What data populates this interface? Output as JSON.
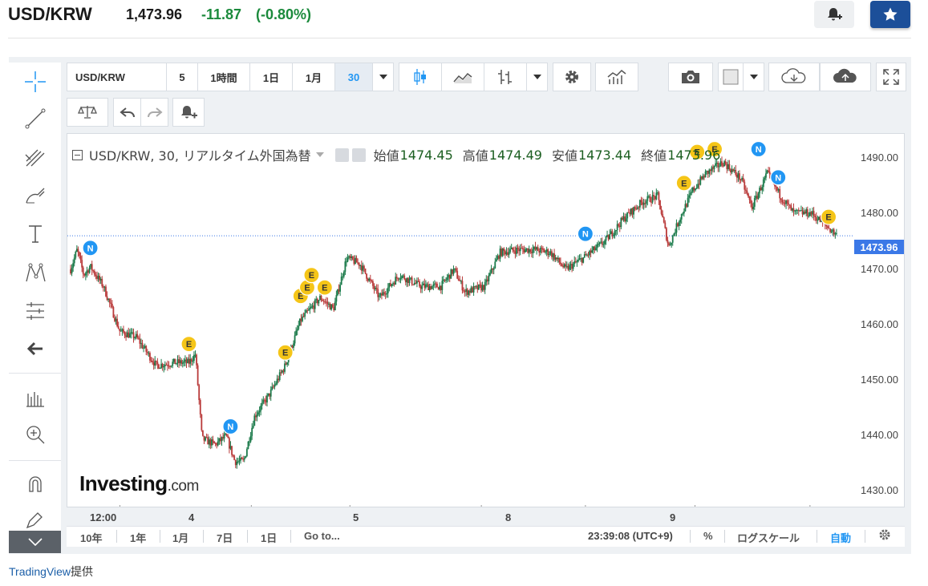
{
  "header": {
    "symbol": "USD/KRW",
    "price": "1,473.96",
    "change": "-11.87",
    "change_pct": "(-0.80%)"
  },
  "toolbar": {
    "symbol": "USD/KRW",
    "intervals": [
      "5",
      "1時間",
      "1日",
      "1月",
      "30"
    ],
    "active_interval": "30"
  },
  "legend": {
    "title": "USD/KRW, 30, リアルタイム外国為替",
    "open_label": "始値",
    "open": "1474.45",
    "high_label": "高値",
    "high": "1474.49",
    "low_label": "安値",
    "low": "1473.44",
    "close_label": "終値",
    "close": "1473.96"
  },
  "y_axis": {
    "labels": [
      "1490.00",
      "1480.00",
      "1470.00",
      "1460.00",
      "1450.00",
      "1440.00",
      "1430.00"
    ],
    "current": "1473.96"
  },
  "x_axis": {
    "labels": [
      "12:00",
      "4",
      "5",
      "8",
      "9"
    ]
  },
  "bottom_bar": {
    "ranges": [
      "10年",
      "1年",
      "1月",
      "7日",
      "1日"
    ],
    "goto": "Go to...",
    "time": "23:39:08 (UTC+9)",
    "percent": "%",
    "log": "ログスケール",
    "auto": "自動"
  },
  "watermark": {
    "brand": "Investing",
    "suffix": ".com"
  },
  "credit": {
    "link": "TradingView",
    "suffix": "提供"
  },
  "colors": {
    "up": "#1b7a4a",
    "down": "#b93a3a",
    "accent": "#2196f3",
    "star_bg": "#1c4f99"
  },
  "chart_data": {
    "type": "candlestick",
    "title": "USD/KRW, 30, リアルタイム外国為替",
    "ylim": [
      1426,
      1492
    ],
    "y_ticks": [
      1430,
      1440,
      1450,
      1460,
      1470,
      1480,
      1490
    ],
    "x_ticks": [
      "12:00",
      "4",
      "5",
      "8",
      "9"
    ],
    "last_price": 1473.96,
    "anchors": [
      {
        "t": 0,
        "v": 1468
      },
      {
        "t": 6,
        "v": 1471.5
      },
      {
        "t": 12,
        "v": 1467
      },
      {
        "t": 18,
        "v": 1468.5
      },
      {
        "t": 30,
        "v": 1465
      },
      {
        "t": 45,
        "v": 1457
      },
      {
        "t": 60,
        "v": 1456
      },
      {
        "t": 78,
        "v": 1451
      },
      {
        "t": 95,
        "v": 1451.5
      },
      {
        "t": 108,
        "v": 1451.5
      },
      {
        "t": 114,
        "v": 1453
      },
      {
        "t": 120,
        "v": 1438
      },
      {
        "t": 132,
        "v": 1437
      },
      {
        "t": 142,
        "v": 1438.5
      },
      {
        "t": 150,
        "v": 1434
      },
      {
        "t": 158,
        "v": 1434
      },
      {
        "t": 168,
        "v": 1442
      },
      {
        "t": 182,
        "v": 1446
      },
      {
        "t": 196,
        "v": 1451
      },
      {
        "t": 210,
        "v": 1459
      },
      {
        "t": 228,
        "v": 1463
      },
      {
        "t": 240,
        "v": 1461
      },
      {
        "t": 252,
        "v": 1470
      },
      {
        "t": 264,
        "v": 1469
      },
      {
        "t": 282,
        "v": 1463
      },
      {
        "t": 300,
        "v": 1467
      },
      {
        "t": 320,
        "v": 1465
      },
      {
        "t": 338,
        "v": 1465
      },
      {
        "t": 350,
        "v": 1468
      },
      {
        "t": 360,
        "v": 1464
      },
      {
        "t": 378,
        "v": 1465
      },
      {
        "t": 392,
        "v": 1471
      },
      {
        "t": 408,
        "v": 1471.5
      },
      {
        "t": 424,
        "v": 1471.5
      },
      {
        "t": 438,
        "v": 1471
      },
      {
        "t": 452,
        "v": 1468
      },
      {
        "t": 468,
        "v": 1470
      },
      {
        "t": 488,
        "v": 1473
      },
      {
        "t": 505,
        "v": 1477
      },
      {
        "t": 522,
        "v": 1480
      },
      {
        "t": 536,
        "v": 1481
      },
      {
        "t": 546,
        "v": 1472
      },
      {
        "t": 556,
        "v": 1477
      },
      {
        "t": 568,
        "v": 1482
      },
      {
        "t": 580,
        "v": 1485
      },
      {
        "t": 596,
        "v": 1487
      },
      {
        "t": 612,
        "v": 1484
      },
      {
        "t": 622,
        "v": 1479
      },
      {
        "t": 636,
        "v": 1485
      },
      {
        "t": 648,
        "v": 1481
      },
      {
        "t": 660,
        "v": 1478
      },
      {
        "t": 676,
        "v": 1478
      },
      {
        "t": 688,
        "v": 1476
      },
      {
        "t": 700,
        "v": 1474
      }
    ],
    "events": [
      {
        "type": "N",
        "t": 18,
        "v": 1471.8
      },
      {
        "type": "E",
        "t": 108,
        "v": 1454.8
      },
      {
        "type": "N",
        "t": 146,
        "v": 1440.2
      },
      {
        "type": "E",
        "t": 196,
        "v": 1453.3
      },
      {
        "t": 210,
        "type": "E",
        "v": 1463.3
      },
      {
        "type": "E",
        "t": 216,
        "v": 1464.8
      },
      {
        "type": "E",
        "t": 220,
        "v": 1467
      },
      {
        "type": "E",
        "t": 232,
        "v": 1464.8
      },
      {
        "type": "N",
        "t": 470,
        "v": 1474.3
      },
      {
        "type": "E",
        "t": 560,
        "v": 1483.3
      },
      {
        "type": "E",
        "t": 572,
        "v": 1488.8
      },
      {
        "type": "E",
        "t": 588,
        "v": 1489.3
      },
      {
        "type": "N",
        "t": 628,
        "v": 1489.3
      },
      {
        "type": "N",
        "t": 646,
        "v": 1484.3
      },
      {
        "type": "E",
        "t": 692,
        "v": 1477.3
      }
    ]
  }
}
